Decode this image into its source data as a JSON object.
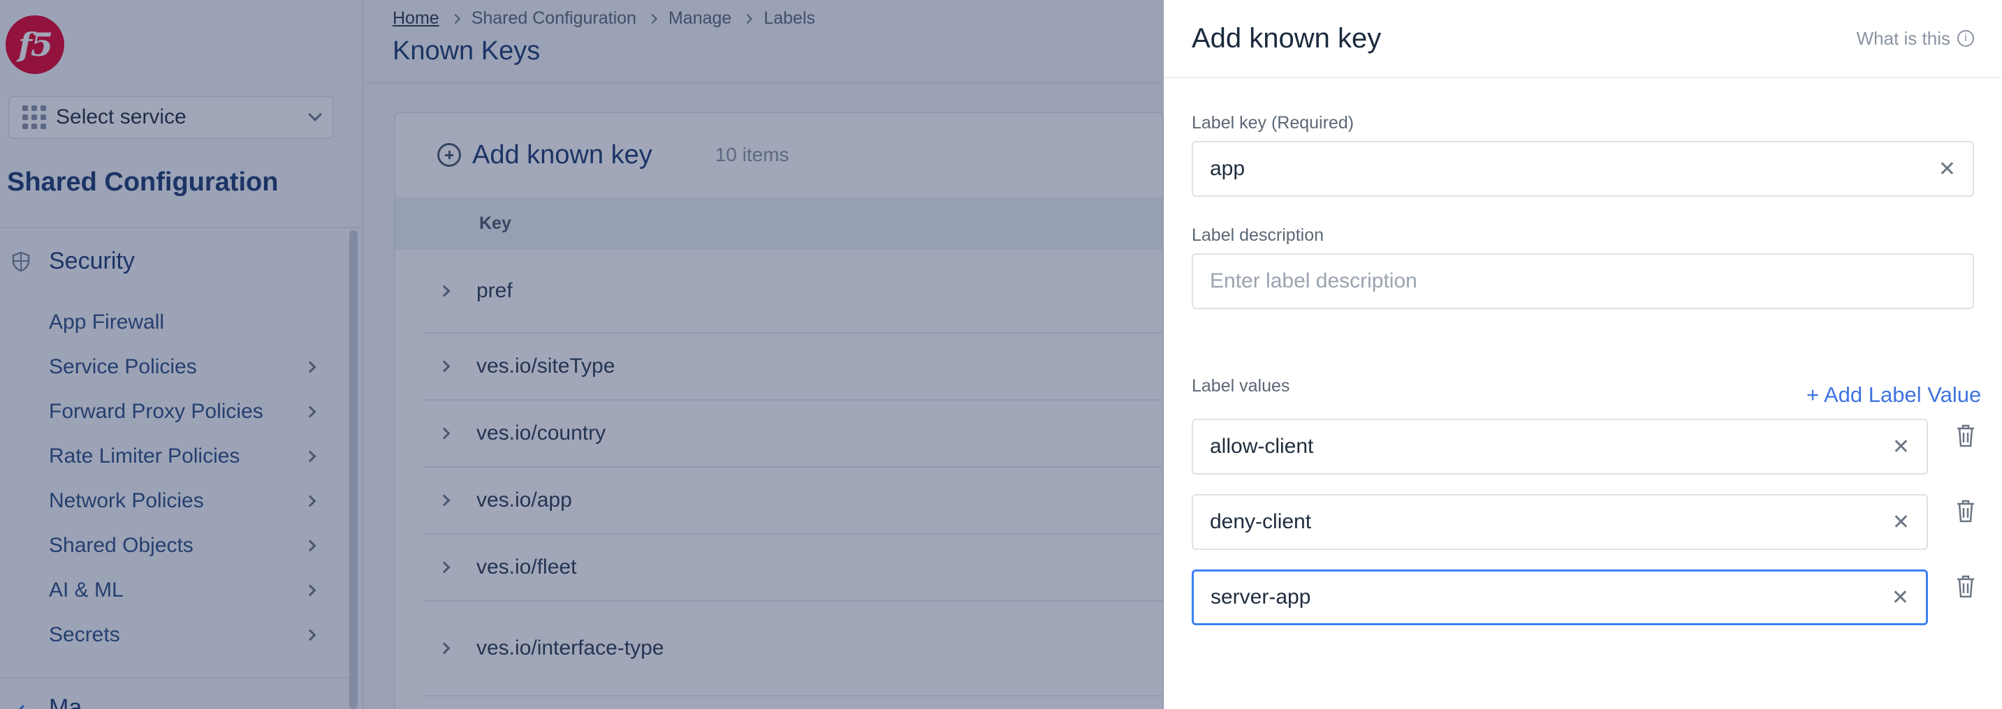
{
  "logo": {
    "text": "f5"
  },
  "sidebar": {
    "service_select": "Select service",
    "workspace_title": "Shared Configuration",
    "section_title": "Security",
    "items": [
      {
        "label": "App Firewall",
        "has_children": false
      },
      {
        "label": "Service Policies",
        "has_children": true
      },
      {
        "label": "Forward Proxy Policies",
        "has_children": true
      },
      {
        "label": "Rate Limiter Policies",
        "has_children": true
      },
      {
        "label": "Network Policies",
        "has_children": true
      },
      {
        "label": "Shared Objects",
        "has_children": true
      },
      {
        "label": "AI & ML",
        "has_children": true
      },
      {
        "label": "Secrets",
        "has_children": true
      }
    ],
    "next_section": "Ma"
  },
  "breadcrumb": [
    "Home",
    "Shared Configuration",
    "Manage",
    "Labels"
  ],
  "page_title": "Known Keys",
  "card": {
    "add_label": "Add known key",
    "count": "10 items",
    "column_key": "Key",
    "rows": [
      "pref",
      "ves.io/siteType",
      "ves.io/country",
      "ves.io/app",
      "ves.io/fleet",
      "ves.io/interface-type"
    ]
  },
  "panel": {
    "title": "Add known key",
    "help": "What is this",
    "key_label": "Label key (Required)",
    "key_value": "app",
    "desc_label": "Label description",
    "desc_placeholder": "Enter label description",
    "values_label": "Label values",
    "add_value": "+ Add Label Value",
    "values": [
      "allow-client",
      "deny-client",
      "server-app"
    ]
  },
  "colors": {
    "accent": "#3f74e0",
    "brand": "#e4002b",
    "nav_text": "#2a4c80",
    "overlay": "#1e2e58"
  }
}
